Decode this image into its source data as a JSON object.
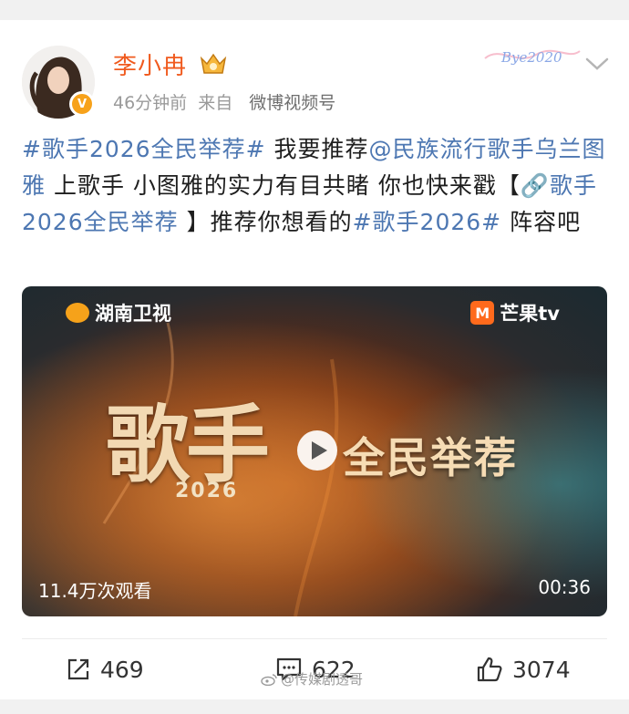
{
  "user": {
    "name": "李小冉",
    "verified_badge": "V"
  },
  "meta": {
    "time": "46分钟前",
    "source_prefix": "来自",
    "source": "微博视频号"
  },
  "decoration_text": "Bye2020",
  "post": {
    "segments": [
      {
        "type": "topic",
        "text": "#歌手2026全民举荐#"
      },
      {
        "type": "text",
        "text": " 我要推荐"
      },
      {
        "type": "mention",
        "text": "@民族流行歌手乌兰图雅"
      },
      {
        "type": "text",
        "text": " 上歌手 小图雅的实力有目共睹 你也快来戳【"
      },
      {
        "type": "link",
        "text": "🔗歌手2026全民举荐 "
      },
      {
        "type": "text",
        "text": "】推荐你想看的"
      },
      {
        "type": "topic",
        "text": "#歌手2026#"
      },
      {
        "type": "text",
        "text": " 阵容吧"
      }
    ]
  },
  "video": {
    "logo_left": "湖南卫视",
    "logo_right": "芒果tv",
    "logo_right_mark": "M",
    "title_big": "歌手",
    "year": "2026",
    "title_right": "全民举荐",
    "views": "11.4万次观看",
    "duration": "00:36"
  },
  "actions": {
    "repost": "469",
    "comment": "622",
    "like": "3074"
  },
  "watermark": "@传媒剧透哥",
  "colors": {
    "accent_orange": "#f05a1e",
    "link_blue": "#4d77b2"
  }
}
